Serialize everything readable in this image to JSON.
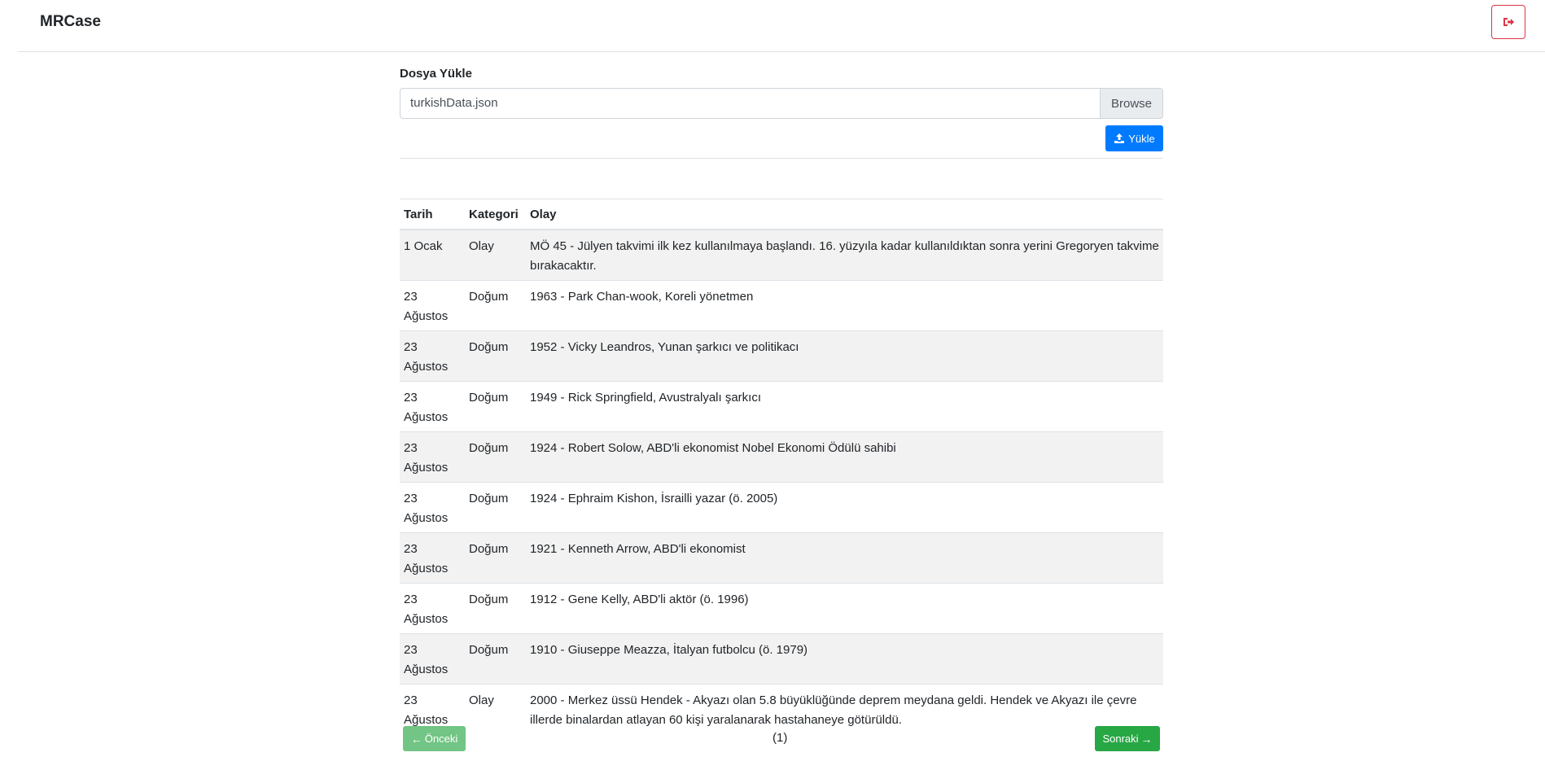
{
  "navbar": {
    "brand": "MRCase",
    "logout_icon": "sign-out-icon",
    "logout_color": "#dc3545"
  },
  "upload": {
    "label": "Dosya Yükle",
    "file_name": "turkishData.json",
    "browse_label": "Browse",
    "upload_label": "Yükle",
    "upload_color": "#007bff"
  },
  "table": {
    "headers": [
      "Tarih",
      "Kategori",
      "Olay"
    ],
    "rows": [
      {
        "date": "1 Ocak",
        "category": "Olay",
        "event": "MÖ 45 - Jülyen takvimi ilk kez kullanılmaya başlandı. 16. yüzyıla kadar kullanıldıktan sonra yerini Gregoryen takvime bırakacaktır."
      },
      {
        "date": "23 Ağustos",
        "category": "Doğum",
        "event": "1963 - Park Chan-wook, Koreli yönetmen"
      },
      {
        "date": "23 Ağustos",
        "category": "Doğum",
        "event": "1952 - Vicky Leandros, Yunan şarkıcı ve politikacı"
      },
      {
        "date": "23 Ağustos",
        "category": "Doğum",
        "event": "1949 - Rick Springfield, Avustralyalı şarkıcı"
      },
      {
        "date": "23 Ağustos",
        "category": "Doğum",
        "event": "1924 - Robert Solow, ABD'li ekonomist Nobel Ekonomi Ödülü sahibi"
      },
      {
        "date": "23 Ağustos",
        "category": "Doğum",
        "event": "1924 - Ephraim Kishon, İsrailli yazar (ö. 2005)"
      },
      {
        "date": "23 Ağustos",
        "category": "Doğum",
        "event": "1921 - Kenneth Arrow, ABD'li ekonomist"
      },
      {
        "date": "23 Ağustos",
        "category": "Doğum",
        "event": "1912 - Gene Kelly, ABD'li aktör (ö. 1996)"
      },
      {
        "date": "23 Ağustos",
        "category": "Doğum",
        "event": "1910 - Giuseppe Meazza, İtalyan futbolcu (ö. 1979)"
      },
      {
        "date": "23 Ağustos",
        "category": "Olay",
        "event": "2000 - Merkez üssü Hendek - Akyazı olan 5.8 büyüklüğünde deprem meydana geldi. Hendek ve Akyazı ile çevre illerde binalardan atlayan 60 kişi yaralanarak hastahaneye götürüldü."
      }
    ]
  },
  "pagination": {
    "prev_label": "Önceki",
    "page_label": "(1)",
    "next_label": "Sonraki",
    "button_color": "#28a745"
  }
}
